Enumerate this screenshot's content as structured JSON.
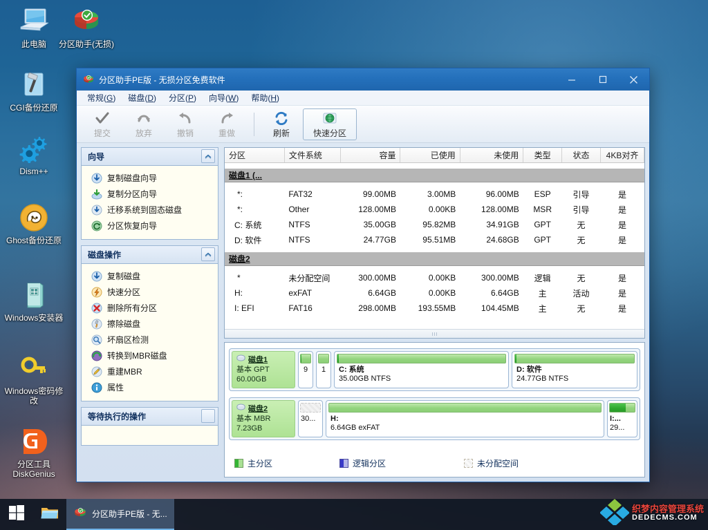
{
  "desktop": {
    "icons": [
      {
        "name": "this-pc",
        "label": "此电脑",
        "icon": "monitor-icon"
      },
      {
        "name": "partition-assistant",
        "label": "分区助手(无损)",
        "icon": "pie-disc-icon"
      },
      {
        "name": "cgi-backup-restore",
        "label": "CGI备份还原",
        "icon": "hammer-icon"
      },
      {
        "name": "dism-plus-plus",
        "label": "Dism++",
        "icon": "gears-icon"
      },
      {
        "name": "ghost-backup-restore",
        "label": "Ghost备份还原",
        "icon": "ghost-icon"
      },
      {
        "name": "windows-installer",
        "label": "Windows安装器",
        "icon": "book-icon"
      },
      {
        "name": "windows-password-reset",
        "label": "Windows密码修改",
        "icon": "key-icon"
      },
      {
        "name": "diskgenius",
        "label": "分区工具 DiskGenius",
        "icon": "dg-logo-icon"
      }
    ]
  },
  "window": {
    "title": "分区助手PE版 - 无损分区免费软件",
    "buttons": {
      "minimize": "—",
      "maximize": "❐",
      "close": "✕"
    },
    "menu": [
      {
        "name": "menu-general",
        "label": "常规(G)",
        "text": "常规(",
        "key": "G",
        "tail": ")"
      },
      {
        "name": "menu-disk",
        "label": "磁盘(D)",
        "text": "磁盘(",
        "key": "D",
        "tail": ")"
      },
      {
        "name": "menu-partition",
        "label": "分区(P)",
        "text": "分区(",
        "key": "P",
        "tail": ")"
      },
      {
        "name": "menu-wizard",
        "label": "向导(W)",
        "text": "向导(",
        "key": "W",
        "tail": ")"
      },
      {
        "name": "menu-help",
        "label": "帮助(H)",
        "text": "帮助(",
        "key": "H",
        "tail": ")"
      }
    ],
    "toolbar": [
      {
        "name": "commit-button",
        "label": "提交",
        "icon": "check-icon",
        "disabled": true
      },
      {
        "name": "discard-button",
        "label": "放弃",
        "icon": "undo-circle-icon",
        "disabled": true
      },
      {
        "name": "undo-button",
        "label": "撤销",
        "icon": "undo-arrow-icon",
        "disabled": true
      },
      {
        "name": "redo-button",
        "label": "重做",
        "icon": "redo-arrow-icon",
        "disabled": true
      },
      {
        "name": "refresh-button",
        "label": "刷新",
        "icon": "refresh-icon",
        "disabled": false
      },
      {
        "name": "quick-partition-button",
        "label": "快速分区",
        "icon": "globe-disk-icon",
        "disabled": false
      }
    ]
  },
  "sidebar": {
    "groups": [
      {
        "name": "wizard-group",
        "title": "向导",
        "collapse": "⌃",
        "items": [
          {
            "name": "copy-disk-wizard",
            "label": "复制磁盘向导",
            "icon": "disk-down-arrow-icon"
          },
          {
            "name": "copy-partition-wizard",
            "label": "复制分区向导",
            "icon": "partition-green-arrow-icon"
          },
          {
            "name": "migrate-os-to-ssd",
            "label": "迁移系统到固态磁盘",
            "icon": "migrate-icon"
          },
          {
            "name": "partition-recovery-wizard",
            "label": "分区恢复向导",
            "icon": "recovery-icon"
          }
        ]
      },
      {
        "name": "disk-operations-group",
        "title": "磁盘操作",
        "collapse": "⌃",
        "items": [
          {
            "name": "copy-disk",
            "label": "复制磁盘",
            "icon": "disk-down-arrow-icon"
          },
          {
            "name": "quick-partition",
            "label": "快速分区",
            "icon": "lightning-icon"
          },
          {
            "name": "delete-all-partitions",
            "label": "删除所有分区",
            "icon": "delete-x-icon"
          },
          {
            "name": "wipe-disk",
            "label": "擦除磁盘",
            "icon": "eraser-icon"
          },
          {
            "name": "bad-sector-check",
            "label": "坏扇区检测",
            "icon": "magnifier-icon"
          },
          {
            "name": "convert-to-mbr-disk",
            "label": "转换到MBR磁盘",
            "icon": "convert-icon"
          },
          {
            "name": "rebuild-mbr",
            "label": "重建MBR",
            "icon": "pencil-icon"
          },
          {
            "name": "properties",
            "label": "属性",
            "icon": "info-icon"
          }
        ]
      },
      {
        "name": "pending-operations-group",
        "title": "等待执行的操作",
        "collapse": "",
        "items": []
      }
    ]
  },
  "table": {
    "columns": [
      {
        "name": "col-partition",
        "label": "分区",
        "align": "l"
      },
      {
        "name": "col-filesystem",
        "label": "文件系统",
        "align": "l"
      },
      {
        "name": "col-capacity",
        "label": "容量",
        "align": "r"
      },
      {
        "name": "col-used",
        "label": "已使用",
        "align": "r"
      },
      {
        "name": "col-unused",
        "label": "未使用",
        "align": "r"
      },
      {
        "name": "col-type",
        "label": "类型",
        "align": "c"
      },
      {
        "name": "col-status",
        "label": "状态",
        "align": "c"
      },
      {
        "name": "col-align4k",
        "label": "4KB对齐",
        "align": "c"
      }
    ],
    "groups": [
      {
        "name": "disk1-group",
        "title": "磁盘1 (...",
        "rows": [
          {
            "partition": "*:",
            "fs": "FAT32",
            "capacity": "99.00MB",
            "used": "3.00MB",
            "unused": "96.00MB",
            "type": "ESP",
            "status": "引导",
            "align": "是"
          },
          {
            "partition": "*:",
            "fs": "Other",
            "capacity": "128.00MB",
            "used": "0.00KB",
            "unused": "128.00MB",
            "type": "MSR",
            "status": "引导",
            "align": "是"
          },
          {
            "partition": "C: 系统",
            "fs": "NTFS",
            "capacity": "35.00GB",
            "used": "95.82MB",
            "unused": "34.91GB",
            "type": "GPT",
            "status": "无",
            "align": "是"
          },
          {
            "partition": "D: 软件",
            "fs": "NTFS",
            "capacity": "24.77GB",
            "used": "95.51MB",
            "unused": "24.68GB",
            "type": "GPT",
            "status": "无",
            "align": "是"
          }
        ]
      },
      {
        "name": "disk2-group",
        "title": "磁盘2",
        "rows": [
          {
            "partition": "*",
            "fs": "未分配空间",
            "capacity": "300.00MB",
            "used": "0.00KB",
            "unused": "300.00MB",
            "type": "逻辑",
            "status": "无",
            "align": "是"
          },
          {
            "partition": "H:",
            "fs": "exFAT",
            "capacity": "6.64GB",
            "used": "0.00KB",
            "unused": "6.64GB",
            "type": "主",
            "status": "活动",
            "align": "是"
          },
          {
            "partition": "I: EFI",
            "fs": "FAT16",
            "capacity": "298.00MB",
            "used": "193.55MB",
            "unused": "104.45MB",
            "type": "主",
            "status": "无",
            "align": "是"
          }
        ]
      }
    ]
  },
  "diskmap": {
    "disks": [
      {
        "name": "disk1-map",
        "title": "磁盘1",
        "scheme": "基本 GPT",
        "size": "60.00GB",
        "segments": [
          {
            "name": "seg-esp",
            "size_class": "tiny",
            "label": "",
            "sub": "9",
            "kind": "primary",
            "used_pct": 3,
            "flex": "0 0 22px"
          },
          {
            "name": "seg-msr",
            "size_class": "tiny",
            "label": "",
            "sub": "1",
            "kind": "primary",
            "used_pct": 0,
            "flex": "0 0 22px"
          },
          {
            "name": "seg-c",
            "size_class": "wide",
            "label": "C: 系统",
            "sub": "35.00GB NTFS",
            "kind": "primary",
            "used_pct": 1,
            "flex": "1 1 0"
          },
          {
            "name": "seg-d",
            "size_class": "wide",
            "label": "D: 软件",
            "sub": "24.77GB NTFS",
            "kind": "primary",
            "used_pct": 1,
            "flex": "0.72 1 0"
          }
        ]
      },
      {
        "name": "disk2-map",
        "title": "磁盘2",
        "scheme": "基本 MBR",
        "size": "7.23GB",
        "segments": [
          {
            "name": "seg-unallocated",
            "size_class": "small",
            "label": "",
            "sub": "30...",
            "kind": "unallocated",
            "used_pct": 0,
            "flex": "0 0 36px"
          },
          {
            "name": "seg-h",
            "size_class": "wide",
            "label": "H:",
            "sub": "6.64GB exFAT",
            "kind": "primary",
            "used_pct": 0,
            "flex": "1 1 0"
          },
          {
            "name": "seg-i",
            "size_class": "small",
            "label": "I:...",
            "sub": "29...",
            "kind": "primary",
            "used_pct": 65,
            "flex": "0 0 44px"
          }
        ]
      }
    ],
    "legend": [
      {
        "name": "legend-primary",
        "label": "主分区",
        "swatch": "prim"
      },
      {
        "name": "legend-logical",
        "label": "逻辑分区",
        "swatch": "logi"
      },
      {
        "name": "legend-unallocated",
        "label": "未分配空间",
        "swatch": "unal"
      }
    ]
  },
  "taskbar": {
    "start": "start-icon",
    "explorer": "folder-icon",
    "app": {
      "name": "taskbar-partition-assistant",
      "label": "分区助手PE版 - 无...",
      "icon": "pie-disc-icon"
    },
    "watermark": {
      "line1": "织梦内容管理系统",
      "line2": "DEDECMS.COM"
    }
  },
  "colors": {
    "titlebar": "#2470bb",
    "accent": "#1c5ea8",
    "panel": "#dde8f4",
    "partition_green": "#8ccf76",
    "used_green": "#2fa82f",
    "disk_header_green": "#aee294",
    "table_group": "#b6b6b6"
  }
}
